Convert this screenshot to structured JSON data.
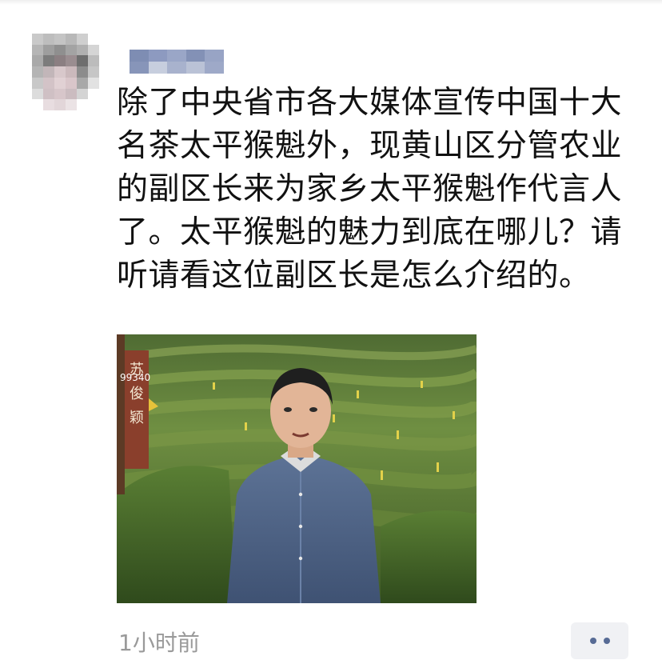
{
  "post": {
    "text": "除了中央省市各大媒体宣传中国十大名茶太平猴魁外，现黄山区分管农业的副区长来为家乡太平猴魁作代言人了。太平猴魁的魅力到底在哪儿？请听请看这位副区长是怎么介绍的。",
    "timestamp": "1小时前"
  },
  "video": {
    "sign_name": "苏俊颖",
    "sign_number": "99340"
  },
  "icons": {
    "more": "more-dots-icon"
  },
  "colors": {
    "link_blue": "#576b95",
    "timestamp_gray": "#9a9a9a",
    "button_bg": "#f0f1f4"
  }
}
